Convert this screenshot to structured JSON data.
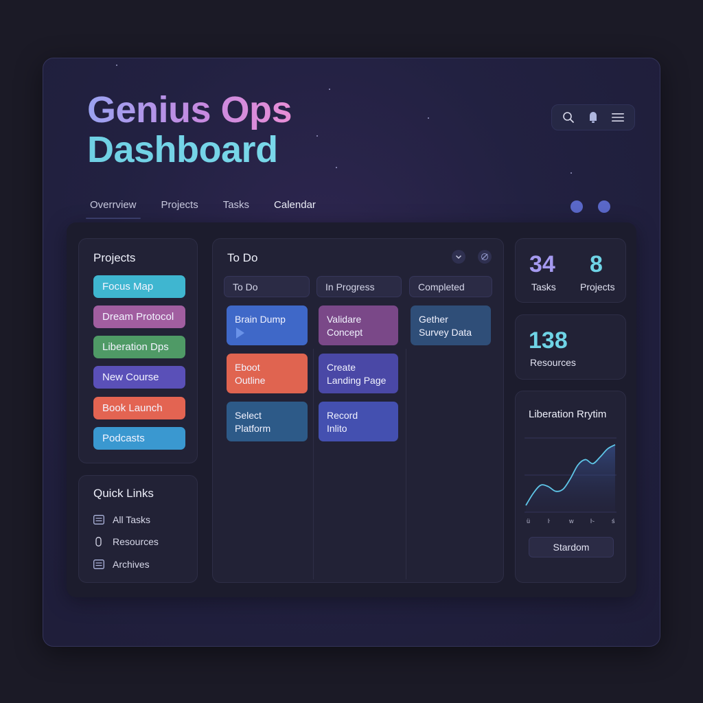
{
  "header": {
    "title_line1": "Genius Ops",
    "title_line2": "Dashboard"
  },
  "toolbar": {
    "icons": [
      "search-icon",
      "bell-icon",
      "menu-icon"
    ]
  },
  "nav": {
    "tabs": [
      "Overrview",
      "Projects",
      "Tasks",
      "Calendar"
    ],
    "active": "Overrview"
  },
  "projects": {
    "title": "Projects",
    "items": [
      {
        "label": "Focus Map",
        "color": "#3fb6d0"
      },
      {
        "label": "Dream Protocol",
        "color": "#a15ea0"
      },
      {
        "label": "Liberation Dps",
        "color": "#4f9a66"
      },
      {
        "label": "New Course",
        "color": "#5a50b8"
      },
      {
        "label": "Book Launch",
        "color": "#e36452"
      },
      {
        "label": "Podcasts",
        "color": "#3a98d0"
      }
    ]
  },
  "quick_links": {
    "title": "Quick Links",
    "items": [
      {
        "label": "All Tasks",
        "icon": "list-icon"
      },
      {
        "label": "Resources",
        "icon": "clip-icon"
      },
      {
        "label": "Archives",
        "icon": "archive-icon"
      }
    ]
  },
  "board": {
    "title": "To Do",
    "columns": [
      {
        "label": "To Do",
        "cards": [
          {
            "lines": [
              "Brain Dump",
              ""
            ],
            "color": "#3f68c8"
          },
          {
            "lines": [
              "Eboot",
              "Outline"
            ],
            "color": "#e06450"
          },
          {
            "lines": [
              "Select",
              "Platform"
            ],
            "color": "#2d5a88"
          }
        ]
      },
      {
        "label": "In Progress",
        "cards": [
          {
            "lines": [
              "Validare",
              "Concept"
            ],
            "color": "#7a4888"
          },
          {
            "lines": [
              "Create",
              "Landing Page"
            ],
            "color": "#4a48a6"
          },
          {
            "lines": [
              "Record",
              "Inlito"
            ],
            "color": "#4450b0"
          }
        ]
      },
      {
        "label": "Completed",
        "cards": [
          {
            "lines": [
              "Gether",
              "Survey Data"
            ],
            "color": "#2f4e78"
          }
        ]
      }
    ]
  },
  "stats": {
    "tasks": {
      "value": "34",
      "label": "Tasks",
      "color": "#a59af0"
    },
    "projects": {
      "value": "8",
      "label": "Projects",
      "color": "#6fd4e6"
    },
    "resources": {
      "value": "138",
      "label": "Resources",
      "color": "#6fd4e6"
    }
  },
  "chart": {
    "title": "Liberation Rrytim",
    "button_label": "Stardom"
  },
  "chart_data": {
    "type": "area",
    "title": "Liberation Rrytim",
    "x_ticks": [
      "ü",
      "ŀ",
      "w",
      "ŀ-",
      "ś"
    ],
    "x": [
      0,
      1,
      2,
      3,
      4,
      5,
      6,
      7,
      8,
      9,
      10,
      11,
      12
    ],
    "values": [
      10,
      28,
      40,
      38,
      31,
      34,
      50,
      70,
      78,
      72,
      82,
      94,
      100
    ],
    "ylim": [
      0,
      110
    ],
    "grid": true,
    "line_color": "#5fc6e8"
  }
}
